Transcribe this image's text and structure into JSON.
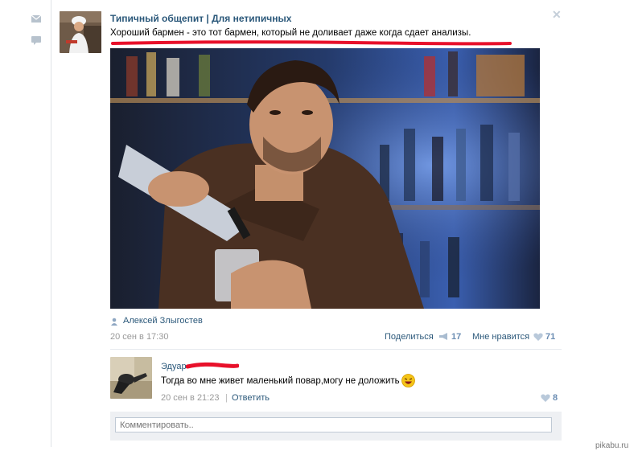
{
  "post": {
    "group_title": "Типичный общепит | Для нетипичных",
    "text": "Хороший бармен - это тот бармен, который не доливает даже когда сдает анализы.",
    "author": "Алексей Злыгостев",
    "date": "20 сен в 17:30",
    "share_label": "Поделиться",
    "share_count": "17",
    "like_label": "Мне нравится",
    "like_count": "71"
  },
  "comment": {
    "author": "Эдуар",
    "text": "Тогда во мне живет маленький повар,могу не доложить",
    "date": "20 сен в 21:23",
    "separator": "|",
    "reply_label": "Ответить",
    "like_count": "8"
  },
  "comment_input": {
    "placeholder": "Комментировать.."
  },
  "watermark": "pikabu.ru",
  "colors": {
    "link": "#2b587a",
    "highlight_underline": "#e8102a",
    "muted": "#999999"
  }
}
